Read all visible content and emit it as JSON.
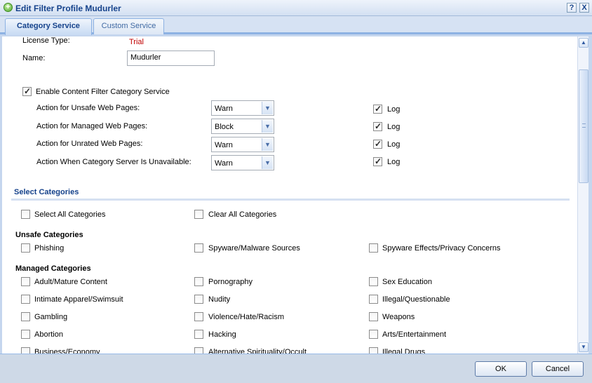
{
  "window": {
    "title": "Edit Filter Profile Mudurler",
    "help_label": "?",
    "close_label": "X"
  },
  "tabs": [
    {
      "label": "Category Service",
      "active": true
    },
    {
      "label": "Custom Service",
      "active": false
    }
  ],
  "license": {
    "label": "License Type:",
    "value": "Trial",
    "value_color": "#c00000"
  },
  "name": {
    "label": "Name:",
    "value": "Mudurler"
  },
  "enable_service": {
    "label": "Enable Content Filter Category Service",
    "checked": true
  },
  "actions": [
    {
      "label": "Action for Unsafe Web Pages:",
      "value": "Warn",
      "log_label": "Log",
      "log_checked": true
    },
    {
      "label": "Action for Managed Web Pages:",
      "value": "Block",
      "log_label": "Log",
      "log_checked": true
    },
    {
      "label": "Action for Unrated Web Pages:",
      "value": "Warn",
      "log_label": "Log",
      "log_checked": true
    },
    {
      "label": "Action When Category Server Is Unavailable:",
      "value": "Warn",
      "log_label": "Log",
      "log_checked": true
    }
  ],
  "select_categories": {
    "title": "Select Categories",
    "select_all": "Select All Categories",
    "clear_all": "Clear All Categories"
  },
  "unsafe": {
    "title": "Unsafe Categories",
    "items": [
      "Phishing",
      "Spyware/Malware Sources",
      "Spyware Effects/Privacy Concerns"
    ]
  },
  "managed": {
    "title": "Managed Categories",
    "items": [
      "Adult/Mature Content",
      "Pornography",
      "Sex Education",
      "Intimate Apparel/Swimsuit",
      "Nudity",
      "Illegal/Questionable",
      "Gambling",
      "Violence/Hate/Racism",
      "Weapons",
      "Abortion",
      "Hacking",
      "Arts/Entertainment",
      "Business/Economy",
      "Alternative Spirituality/Occult",
      "Illegal Drugs"
    ]
  },
  "footer": {
    "ok_label": "OK",
    "cancel_label": "Cancel"
  },
  "colors": {
    "title_text": "#15428b",
    "accent": "#99bbe8"
  }
}
